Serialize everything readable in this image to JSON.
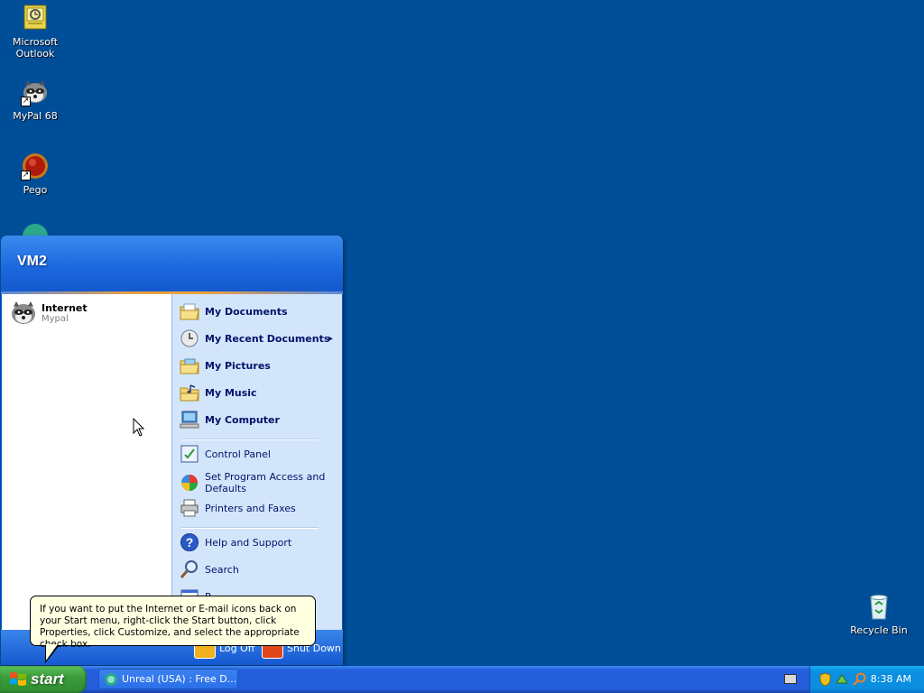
{
  "desktop": {
    "icons": [
      {
        "label": "Microsoft Outlook",
        "icon": "outlook-icon"
      },
      {
        "label": "MyPal 68",
        "icon": "mypal-icon"
      },
      {
        "label": "Pego",
        "icon": "pego-icon"
      },
      {
        "label": "Recycle Bin",
        "icon": "recycle-bin-icon"
      }
    ]
  },
  "start_menu": {
    "user": "VM2",
    "pinned": [
      {
        "title": "Internet",
        "subtitle": "Mypal",
        "icon": "mypal-icon"
      }
    ],
    "right_items": [
      {
        "label": "My Documents",
        "icon": "my-documents-icon"
      },
      {
        "label": "My Recent Documents",
        "icon": "recent-documents-icon",
        "submenu_arrow": "▸"
      },
      {
        "label": "My Pictures",
        "icon": "my-pictures-icon"
      },
      {
        "label": "My Music",
        "icon": "my-music-icon"
      },
      {
        "label": "My Computer",
        "icon": "my-computer-icon"
      },
      {
        "label": "Control Panel",
        "icon": "control-panel-icon"
      },
      {
        "label": "Set Program Access and Defaults",
        "icon": "program-access-icon"
      },
      {
        "label": "Printers and Faxes",
        "icon": "printer-icon"
      },
      {
        "label": "Help and Support",
        "icon": "help-icon"
      },
      {
        "label": "Search",
        "icon": "search-icon"
      },
      {
        "label": "R",
        "icon": "run-icon"
      }
    ],
    "footer": {
      "log_off": "Log Off",
      "shut_down": "Shut Down"
    }
  },
  "tooltip": {
    "text": "If you want to put the Internet or E-mail icons back on your Start menu, right-click the Start button, click Properties, click Customize, and select the appropriate check box."
  },
  "taskbar": {
    "start_label": "start",
    "tasks": [
      {
        "label": "Unreal (USA) : Free D...",
        "icon": "mypal-icon"
      }
    ],
    "tray_icons": [
      "security-shield-icon",
      "network-icon",
      "search-icon"
    ],
    "clock": "8:38 AM"
  },
  "colors": {
    "desktop": "#004e98",
    "start_green": "#3c9c3c",
    "menu_blue": "#1458cc",
    "tooltip_bg": "#ffffe1"
  }
}
